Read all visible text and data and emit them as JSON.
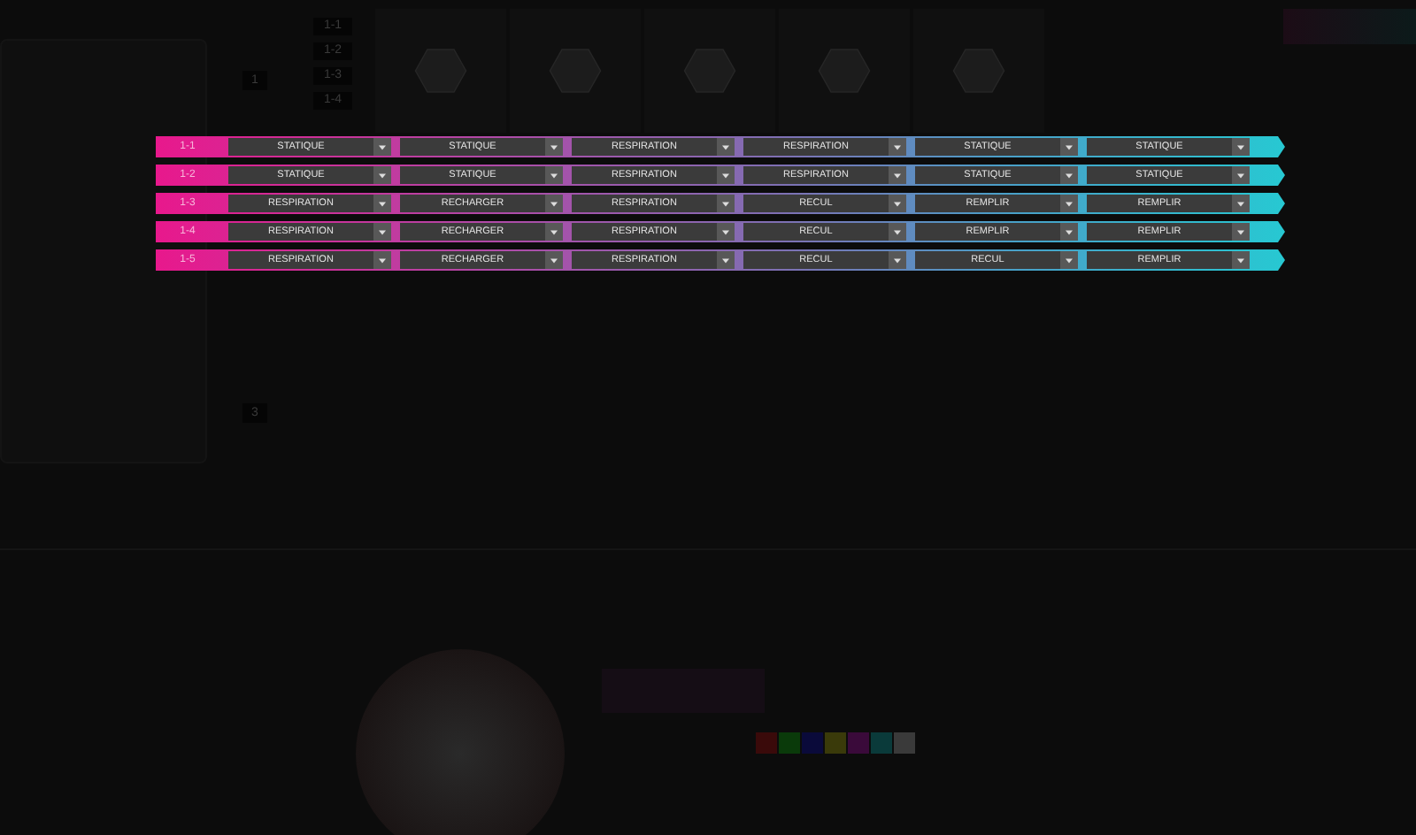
{
  "ports": [
    {
      "label": "1-1"
    },
    {
      "label": "1-2"
    },
    {
      "label": "1-3"
    },
    {
      "label": "1-4"
    }
  ],
  "hub_labels": [
    {
      "label": "1"
    },
    {
      "label": "3"
    }
  ],
  "effect_rows": [
    {
      "label": "1-1",
      "modes": [
        "STATIQUE",
        "STATIQUE",
        "RESPIRATION",
        "RESPIRATION",
        "STATIQUE",
        "STATIQUE"
      ]
    },
    {
      "label": "1-2",
      "modes": [
        "STATIQUE",
        "STATIQUE",
        "RESPIRATION",
        "RESPIRATION",
        "STATIQUE",
        "STATIQUE"
      ]
    },
    {
      "label": "1-3",
      "modes": [
        "RESPIRATION",
        "RECHARGER",
        "RESPIRATION",
        "RECUL",
        "REMPLIR",
        "REMPLIR"
      ]
    },
    {
      "label": "1-4",
      "modes": [
        "RESPIRATION",
        "RECHARGER",
        "RESPIRATION",
        "RECUL",
        "REMPLIR",
        "REMPLIR"
      ]
    },
    {
      "label": "1-5",
      "modes": [
        "RESPIRATION",
        "RECHARGER",
        "RESPIRATION",
        "RECUL",
        "RECUL",
        "REMPLIR"
      ]
    }
  ],
  "swatches": [
    {
      "color": "#3a0a0a"
    },
    {
      "color": "#0a3a0a"
    },
    {
      "color": "#0a0a3a"
    },
    {
      "color": "#3a3a0a"
    },
    {
      "color": "#3a0a3a"
    },
    {
      "color": "#0a3a3a"
    },
    {
      "color": "#3a3a3a"
    }
  ]
}
